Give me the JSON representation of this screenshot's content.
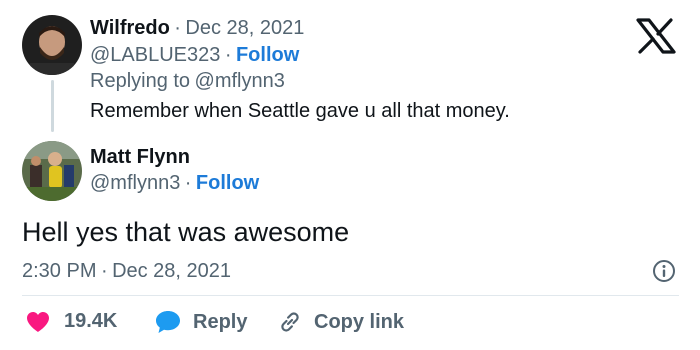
{
  "reply": {
    "author_name": "Wilfredo",
    "date": "Dec 28, 2021",
    "handle": "@LABLUE323",
    "follow_label": "Follow",
    "replying_prefix": "Replying to",
    "replying_handle": "@mflynn3",
    "text": "Remember when Seattle gave u all that money."
  },
  "tweet": {
    "author_name": "Matt Flynn",
    "handle": "@mflynn3",
    "follow_label": "Follow",
    "text": "Hell yes that was awesome",
    "time": "2:30 PM",
    "date": "Dec 28, 2021"
  },
  "actions": {
    "likes": "19.4K",
    "reply_label": "Reply",
    "copy_link_label": "Copy link"
  },
  "separator": "·",
  "icons": {
    "logo": "x-logo-icon",
    "info": "info-icon",
    "like": "heart-icon",
    "reply": "chat-bubble-icon",
    "copy": "link-icon"
  },
  "colors": {
    "heart": "#f91880",
    "reply_bubble": "#1d9bf0",
    "follow": "#1d7bd8",
    "muted": "#536471"
  }
}
